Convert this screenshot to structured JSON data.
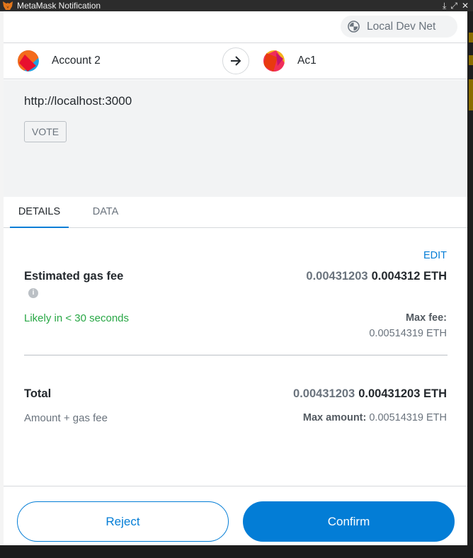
{
  "window": {
    "title": "MetaMask Notification",
    "controls": [
      "⤓",
      "⤢",
      "✕"
    ]
  },
  "network": {
    "name": "Local Dev Net",
    "icon": "network-icon"
  },
  "accounts": {
    "from": {
      "name": "Account 2",
      "icon": "identicon"
    },
    "to": {
      "name": "Ac1",
      "icon": "identicon"
    },
    "arrow_icon": "arrow-right-icon"
  },
  "transaction": {
    "origin": "http://localhost:3000",
    "method": "VOTE"
  },
  "tabs": [
    {
      "label": "DETAILS",
      "active": true
    },
    {
      "label": "DATA",
      "active": false
    }
  ],
  "details": {
    "edit_label": "EDIT",
    "gas_fee": {
      "label": "Estimated gas fee",
      "secondary": "0.00431203",
      "primary": "0.004312 ETH",
      "timing": "Likely in < 30 seconds",
      "max_fee_label": "Max fee:",
      "max_fee_value": "0.00514319 ETH"
    },
    "total": {
      "label": "Total",
      "secondary": "0.00431203",
      "primary": "0.00431203 ETH",
      "sub_label": "Amount + gas fee",
      "max_amount_label": "Max amount:",
      "max_amount_value": "0.00514319 ETH"
    }
  },
  "footer": {
    "reject_label": "Reject",
    "confirm_label": "Confirm"
  },
  "colors": {
    "accent": "#037dd6",
    "success": "#28a745",
    "text": "#24292e",
    "muted": "#6a737d"
  }
}
